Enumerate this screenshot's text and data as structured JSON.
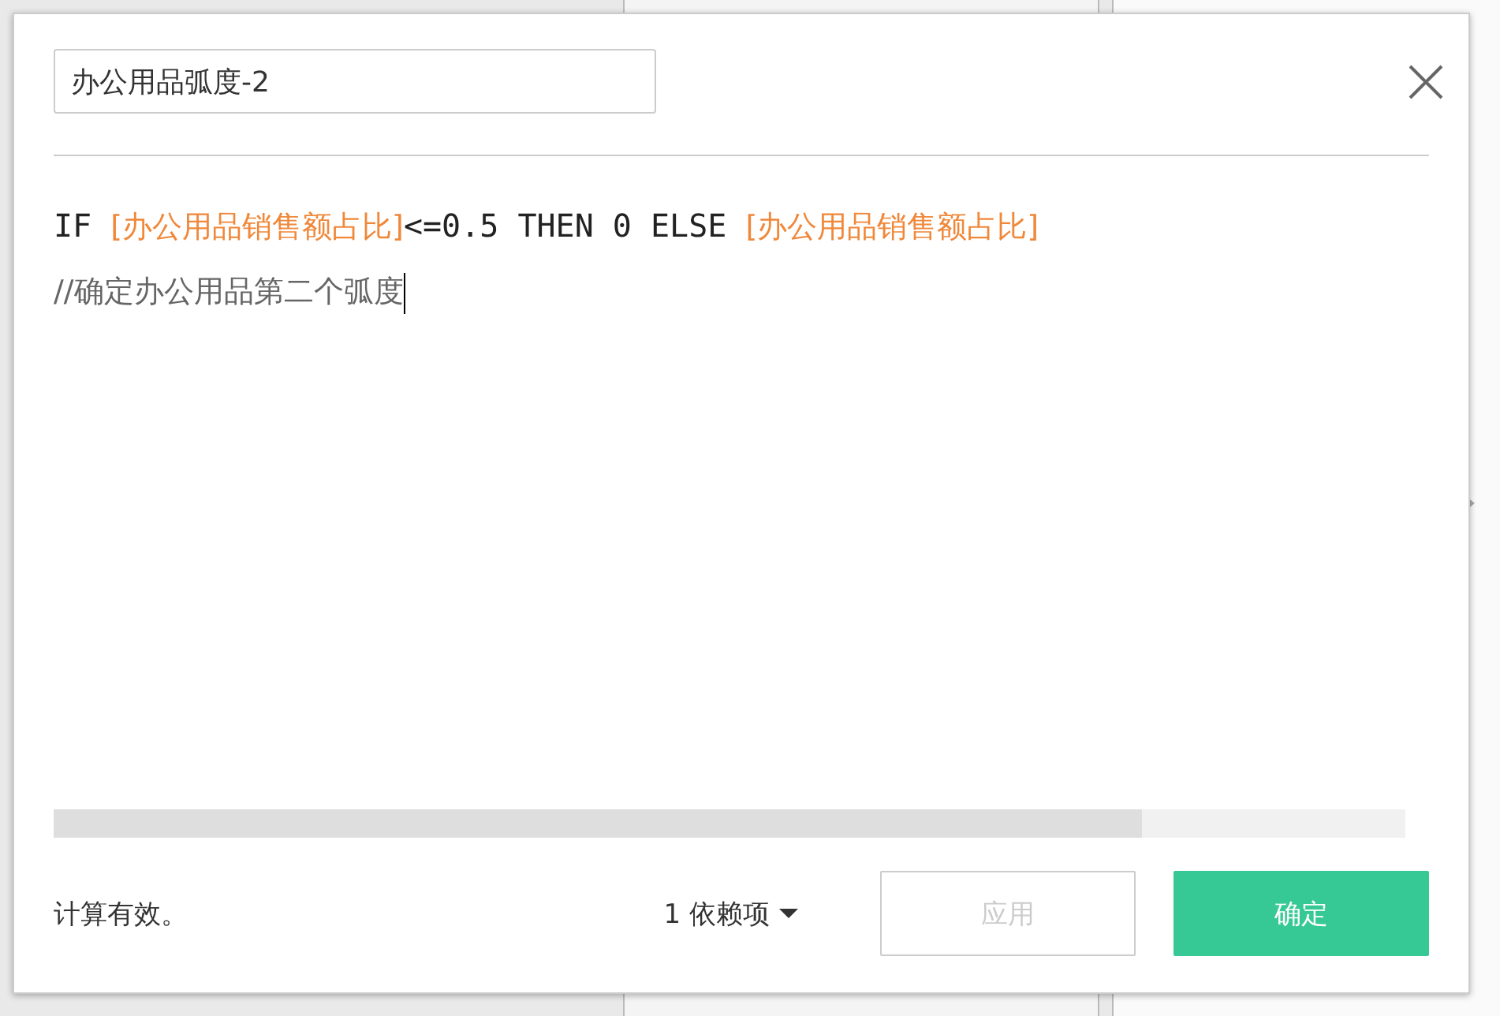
{
  "dialog": {
    "name_field": {
      "value": "办公用品弧度-2"
    },
    "editor": {
      "lines": [
        [
          {
            "kind": "code",
            "text": "IF "
          },
          {
            "kind": "field",
            "text": "[办公用品销售额占比]"
          },
          {
            "kind": "code",
            "text": "<=0.5 THEN 0 ELSE "
          },
          {
            "kind": "field",
            "text": "[办公用品销售额占比]"
          }
        ],
        [
          {
            "kind": "comment",
            "text": "//确定办公用品第二个弧度"
          }
        ]
      ]
    },
    "status": "计算有效。",
    "dependencies": "1 依赖项",
    "buttons": [
      {
        "label": "应用",
        "kind": "secondary",
        "disabled": true
      },
      {
        "label": "确定",
        "kind": "primary",
        "disabled": false
      }
    ]
  }
}
